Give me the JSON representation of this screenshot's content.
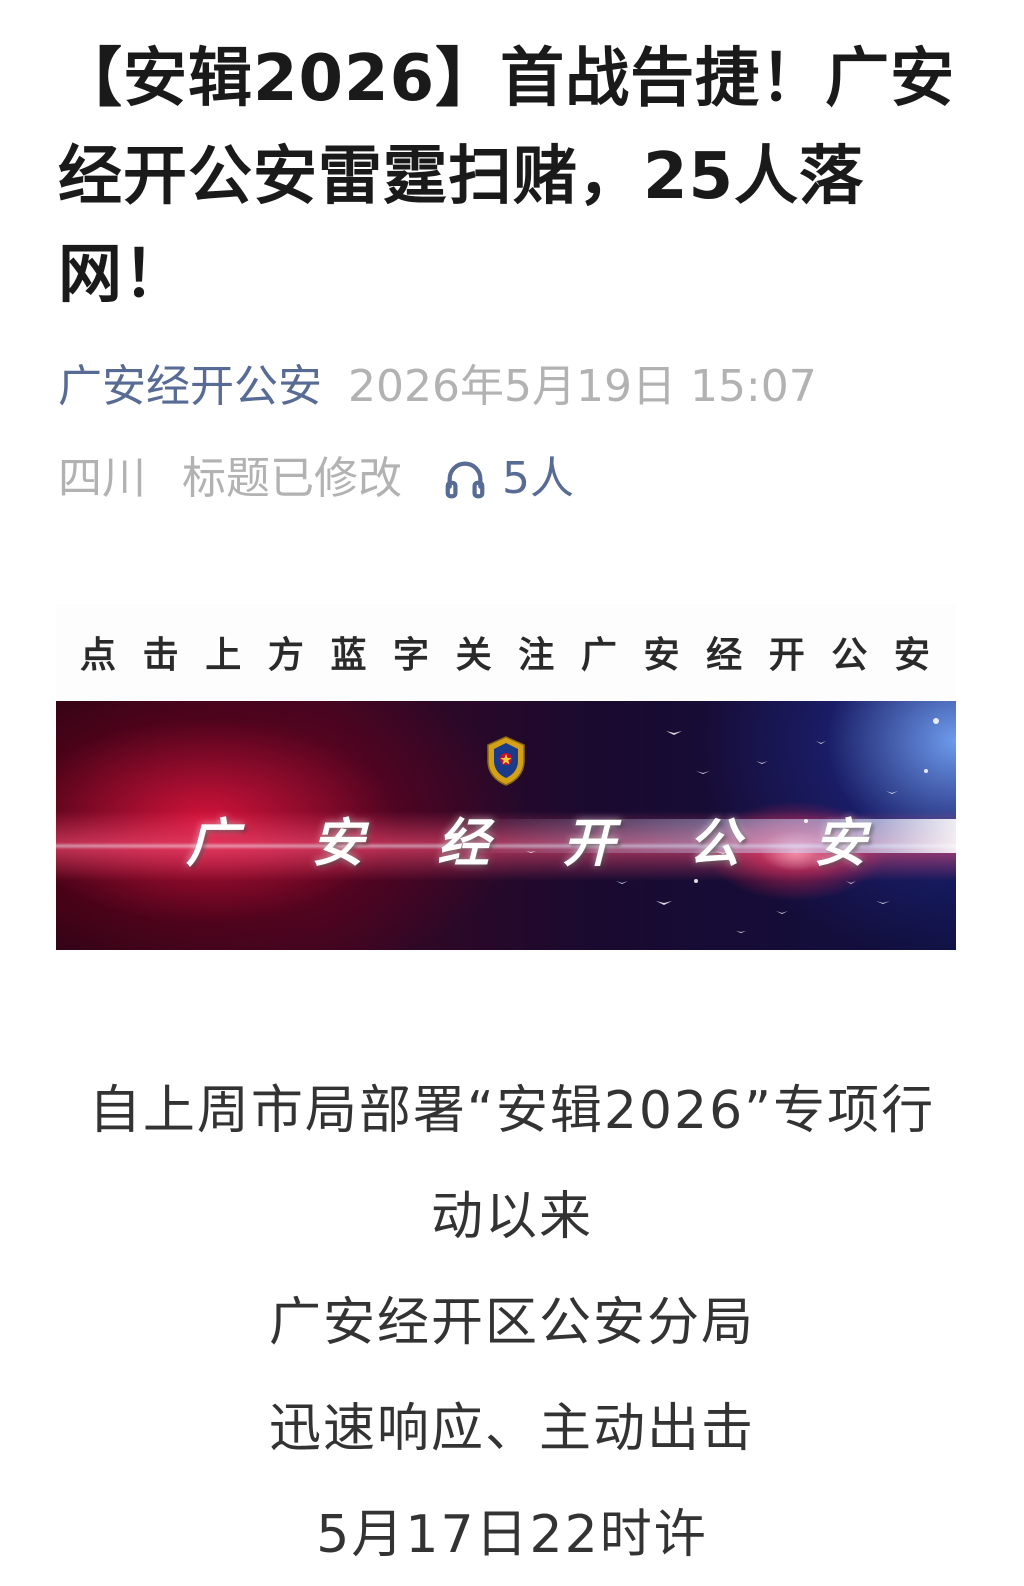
{
  "article": {
    "title": "【安辑2026】首战告捷！广安经开公安雷霆扫赌，25人落网！"
  },
  "meta": {
    "account_name": "广安经开公安",
    "publish_time": "2026年5月19日 15:07",
    "region": "四川",
    "edited_note": "标题已修改",
    "listen_icon": "headphones-icon",
    "listen_count": "5人"
  },
  "follow_strip": {
    "chars": [
      "点",
      "击",
      "上",
      "方",
      "蓝",
      "字",
      "关",
      "注",
      "广",
      "安",
      "经",
      "开",
      "公",
      "安"
    ]
  },
  "banner": {
    "chars": [
      "广",
      "安",
      "经",
      "开",
      "公",
      "安"
    ],
    "emblem_icon": "police-emblem-icon"
  },
  "body": {
    "lines": [
      "自上周市局部署“安辑2026”专项行",
      "动以来",
      "广安经开区公安分局",
      "迅速响应、主动出击",
      "5月17日22时许"
    ]
  },
  "colors": {
    "link_blue": "#576b95",
    "meta_gray": "#b2b2b2",
    "title_black": "#1a1a1a",
    "body_text": "#333333"
  }
}
